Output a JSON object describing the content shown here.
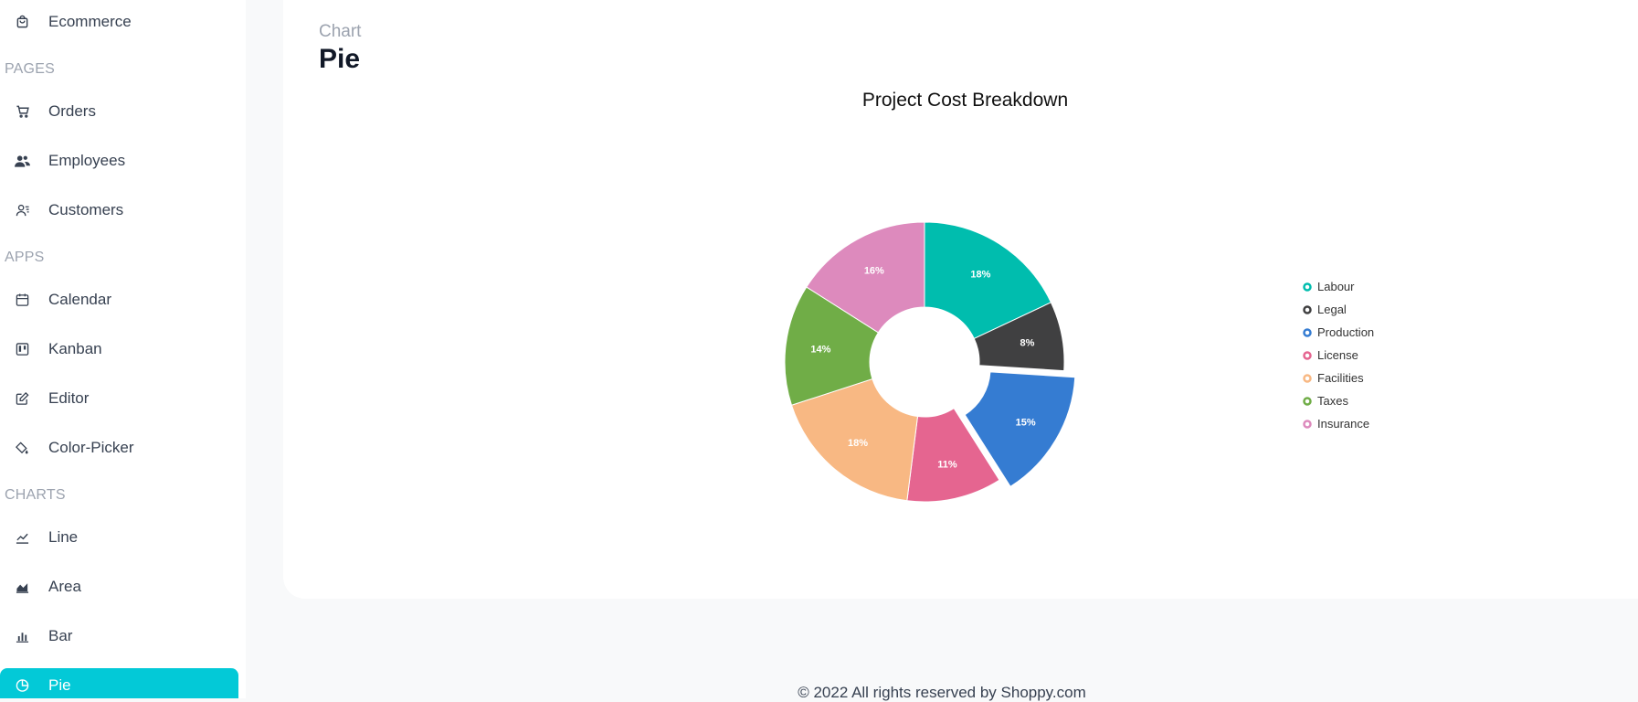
{
  "sidebar": {
    "items": [
      {
        "key": "ecommerce",
        "type": "item",
        "label": "Ecommerce",
        "icon": "shopping-bag-icon"
      },
      {
        "key": "pages",
        "type": "section",
        "label": "PAGES"
      },
      {
        "key": "orders",
        "type": "item",
        "label": "Orders",
        "icon": "cart-icon"
      },
      {
        "key": "employees",
        "type": "item",
        "label": "Employees",
        "icon": "users-icon"
      },
      {
        "key": "customers",
        "type": "item",
        "label": "Customers",
        "icon": "contacts-icon"
      },
      {
        "key": "apps",
        "type": "section",
        "label": "APPS"
      },
      {
        "key": "calendar",
        "type": "item",
        "label": "Calendar",
        "icon": "calendar-icon"
      },
      {
        "key": "kanban",
        "type": "item",
        "label": "Kanban",
        "icon": "kanban-icon"
      },
      {
        "key": "editor",
        "type": "item",
        "label": "Editor",
        "icon": "edit-icon"
      },
      {
        "key": "color-picker",
        "type": "item",
        "label": "Color-Picker",
        "icon": "paint-bucket-icon"
      },
      {
        "key": "charts",
        "type": "section",
        "label": "CHARTS"
      },
      {
        "key": "line",
        "type": "item",
        "label": "Line",
        "icon": "line-chart-icon"
      },
      {
        "key": "area",
        "type": "item",
        "label": "Area",
        "icon": "area-chart-icon"
      },
      {
        "key": "bar",
        "type": "item",
        "label": "Bar",
        "icon": "bar-chart-icon"
      },
      {
        "key": "pie",
        "type": "item",
        "label": "Pie",
        "icon": "pie-chart-icon",
        "active": true
      }
    ],
    "active_color": "#03c9d7"
  },
  "header": {
    "breadcrumb": "Chart",
    "title": "Pie"
  },
  "footer": {
    "text": "© 2022 All rights reserved by Shoppy.com"
  },
  "chart_data": {
    "type": "pie",
    "donut": true,
    "title": "Project Cost Breakdown",
    "legend_position": "right",
    "exploded": "Production",
    "categories": [
      "Labour",
      "Legal",
      "Production",
      "License",
      "Facilities",
      "Taxes",
      "Insurance"
    ],
    "values": [
      18,
      8,
      15,
      11,
      18,
      14,
      16
    ],
    "labels": [
      "18%",
      "8%",
      "15%",
      "11%",
      "18%",
      "14%",
      "16%"
    ],
    "colors": [
      "#00bdae",
      "#404041",
      "#357cd2",
      "#e56590",
      "#f8b883",
      "#70ad47",
      "#dd8abd"
    ]
  }
}
